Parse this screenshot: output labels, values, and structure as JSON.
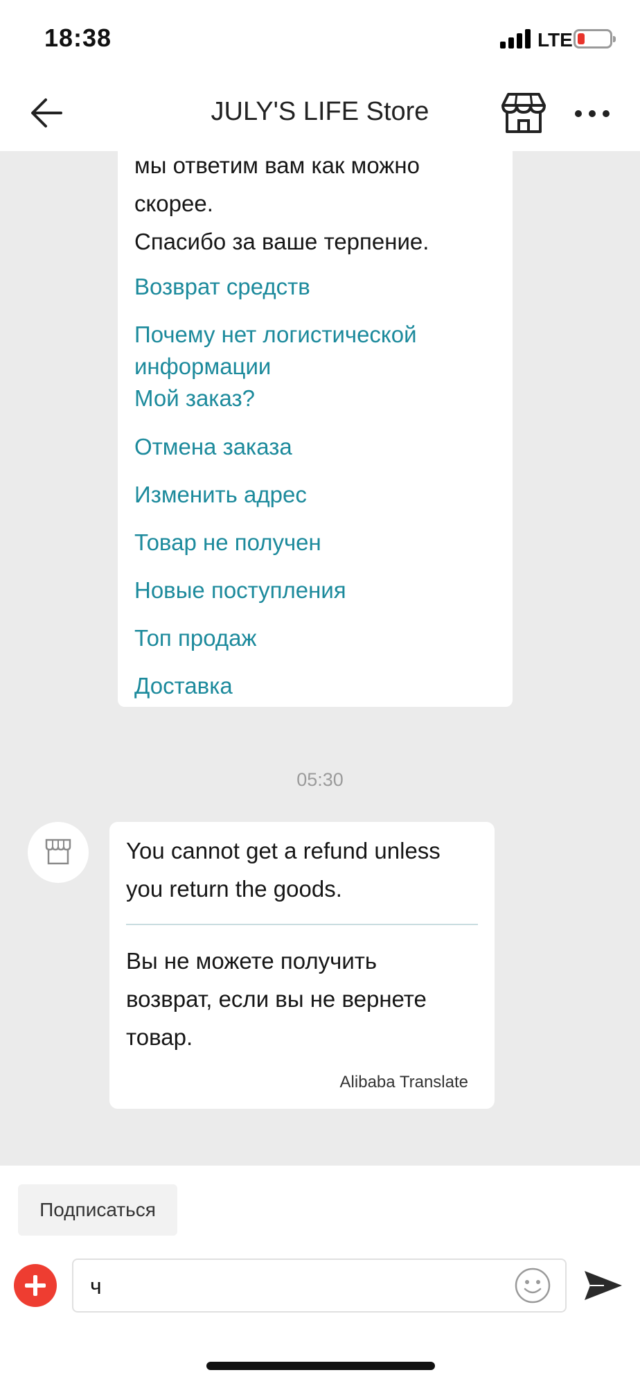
{
  "status_bar": {
    "time": "18:38",
    "network": "LTE"
  },
  "header": {
    "title": "JULY'S LIFE Store"
  },
  "chat": {
    "first_message": {
      "text_lines": [
        "мы ответим вам как можно",
        "скорее.",
        "Спасибо за ваше терпение."
      ],
      "links": [
        "Возврат средств",
        "Почему нет логистической",
        "информации",
        "Мой заказ?",
        "Отмена заказа",
        "Изменить адрес",
        "Товар не получен",
        "Новые поступления",
        "Топ продаж",
        "Доставка"
      ]
    },
    "timestamp": "05:30",
    "second_message": {
      "original_lines": [
        "You cannot get a refund unless",
        "you return the goods."
      ],
      "translated_lines": [
        "Вы не можете получить",
        "возврат, если вы не вернете",
        "товар."
      ],
      "credit": "Alibaba Translate"
    }
  },
  "bottom": {
    "subscribe_label": "Подписаться",
    "input_value": "ч"
  },
  "colors": {
    "link": "#1c8a9c",
    "accent_red": "#ee3d31",
    "chat_bg": "#ebebeb"
  },
  "icons": [
    "back-arrow-icon",
    "store-icon",
    "more-icon",
    "plus-icon",
    "emoji-icon",
    "send-icon"
  ]
}
